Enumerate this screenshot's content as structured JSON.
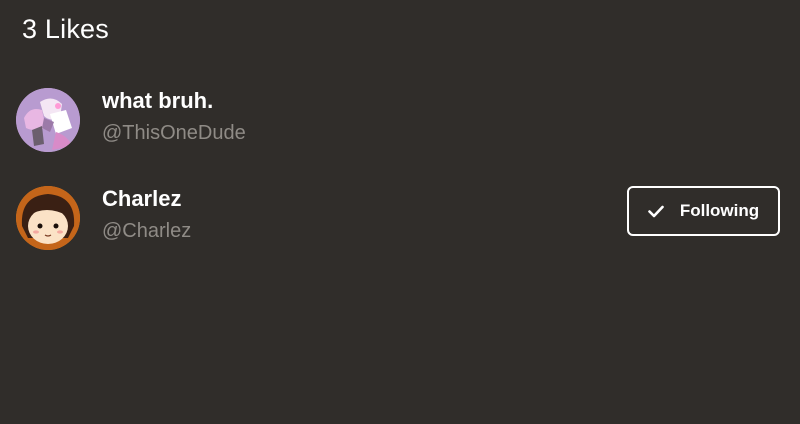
{
  "header": {
    "title": "3 Likes"
  },
  "users": [
    {
      "display_name": "what bruh.",
      "handle": "@ThisOneDude",
      "avatar_icon": "avatar-anime-character-pink"
    },
    {
      "display_name": "Charlez",
      "handle": "@Charlez",
      "avatar_icon": "avatar-cartoon-face",
      "follow_button": {
        "label": "Following",
        "icon": "check-icon"
      }
    }
  ],
  "colors": {
    "background": "#302d2a",
    "text_primary": "#ffffff",
    "text_secondary": "#8f8b86",
    "button_border": "#ffffff"
  }
}
